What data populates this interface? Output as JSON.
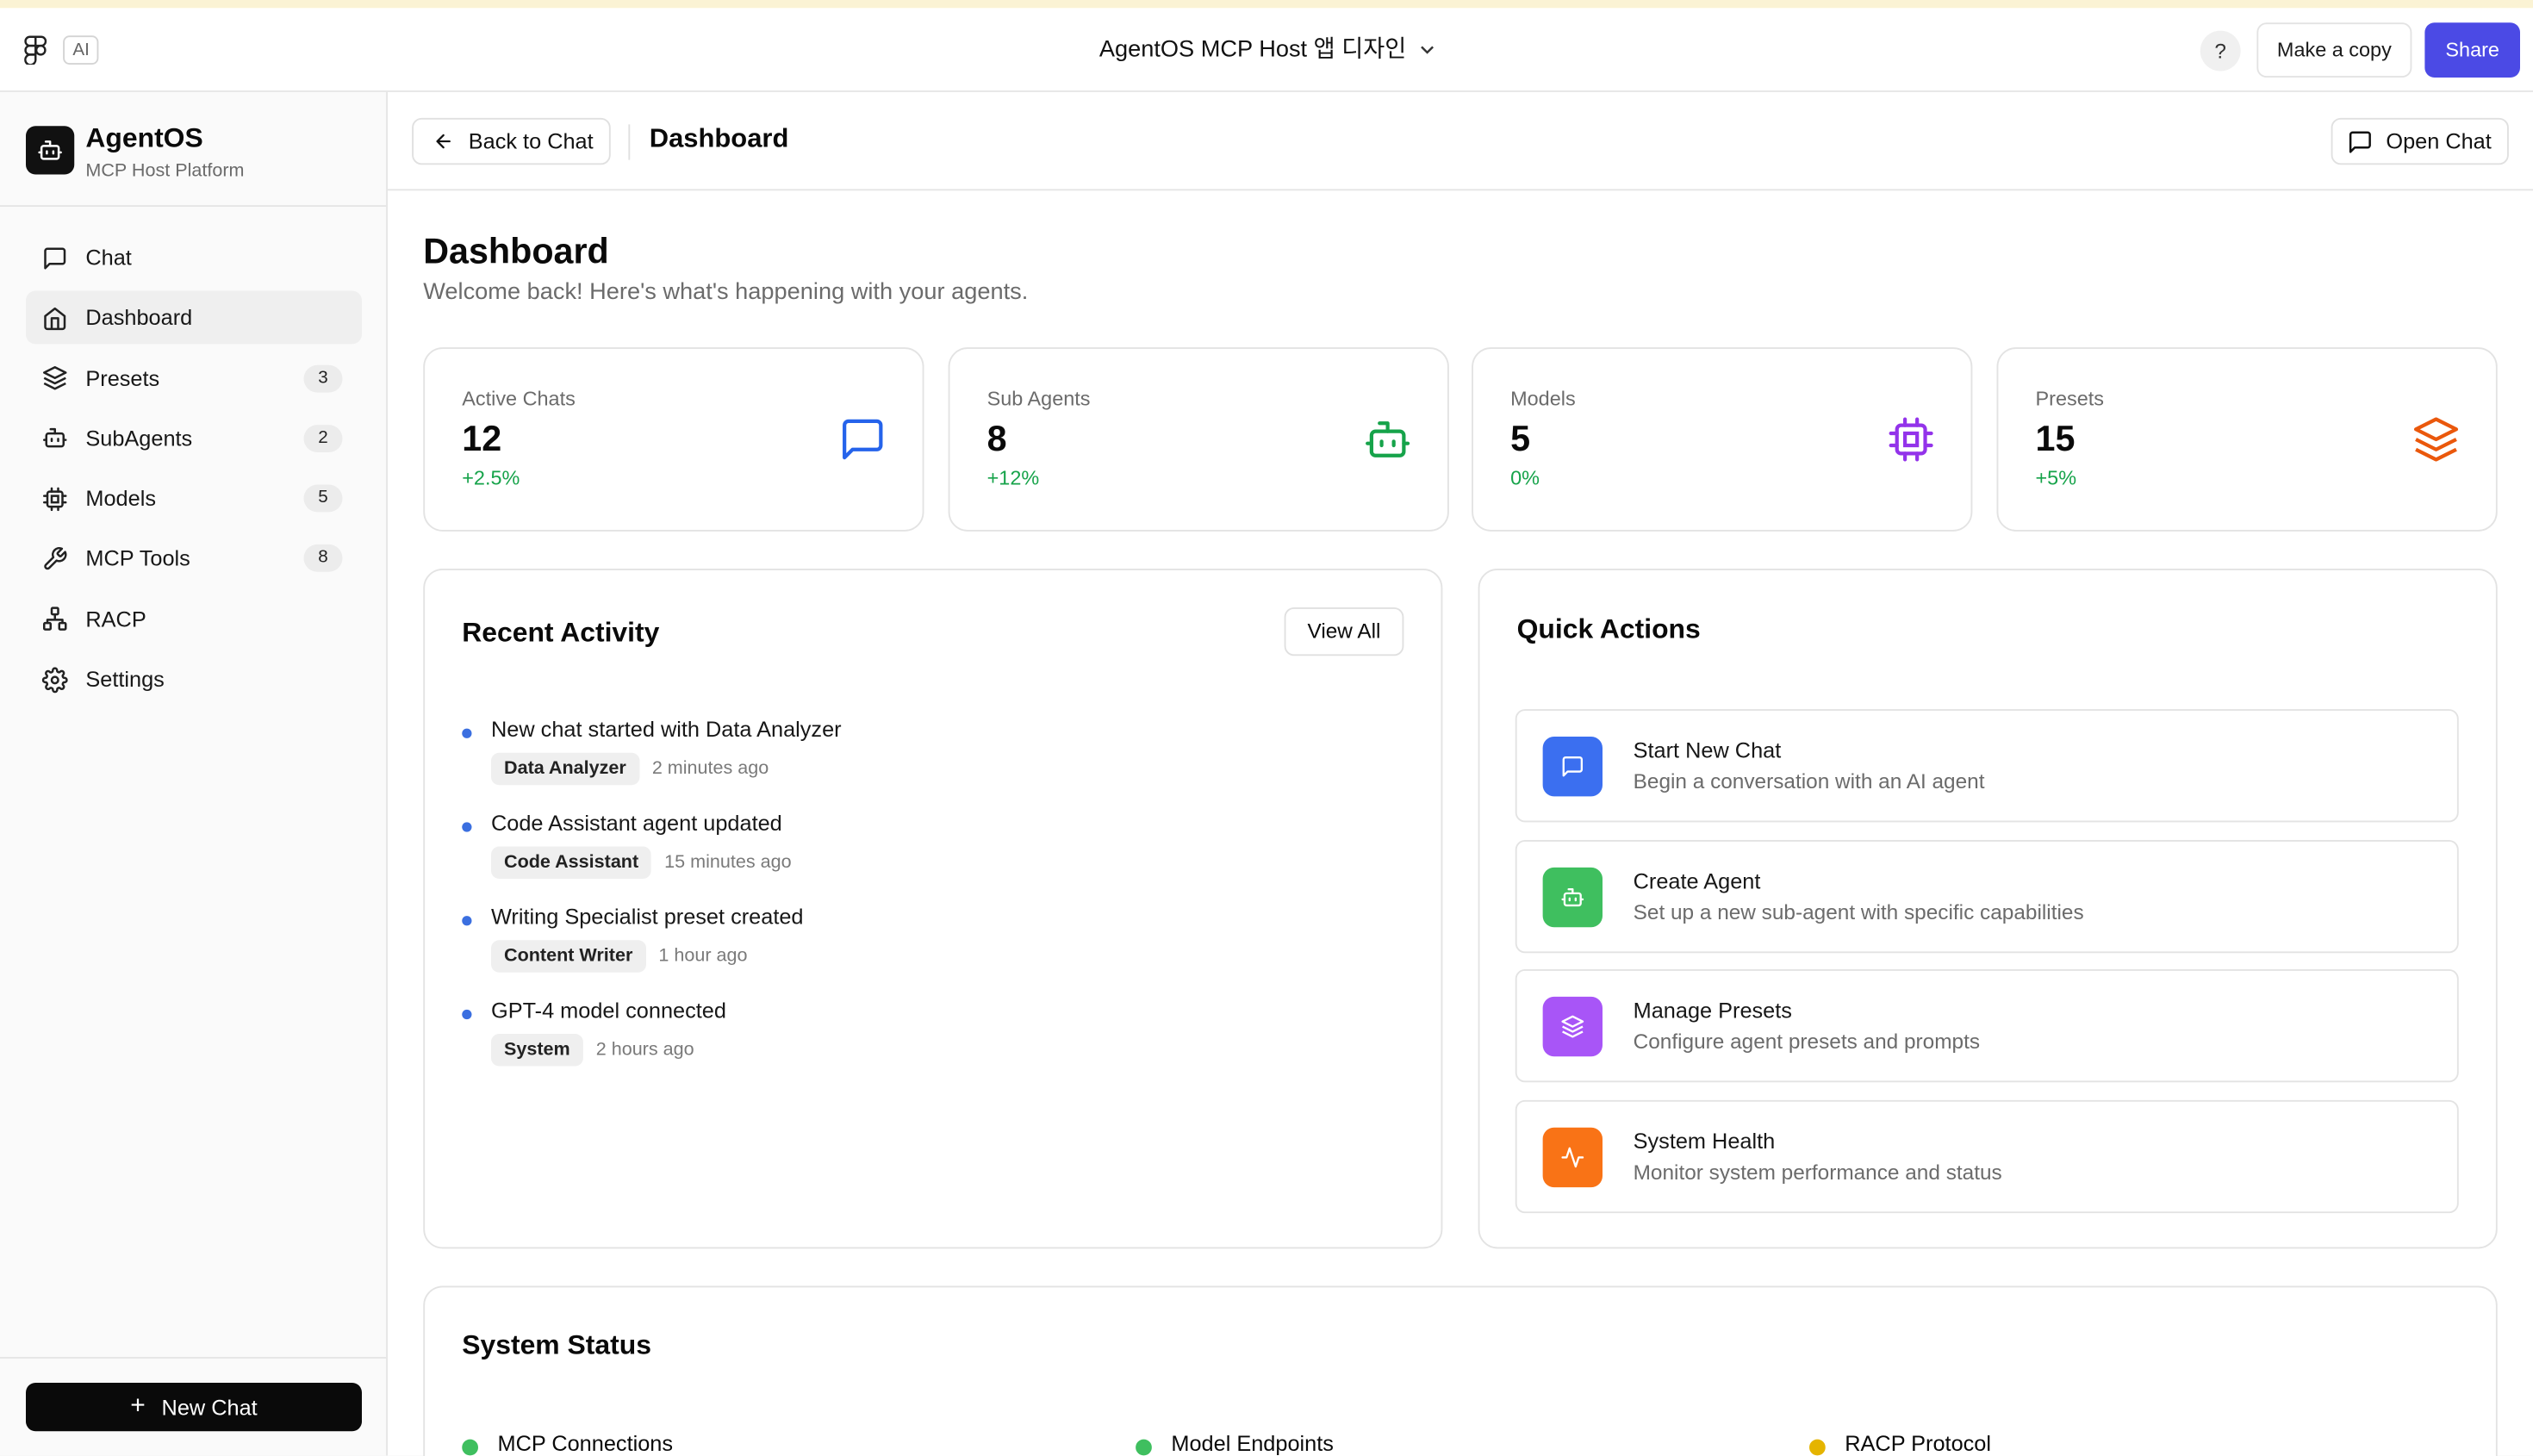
{
  "figma": {
    "ai_chip": "AI",
    "file_title": "AgentOS MCP Host 앱 디자인",
    "help": "?",
    "make_copy": "Make a copy",
    "share": "Share"
  },
  "sidebar": {
    "brand_name": "AgentOS",
    "brand_sub": "MCP Host Platform",
    "items": [
      {
        "label": "Chat",
        "icon": "chat-icon",
        "badge": null,
        "active": false
      },
      {
        "label": "Dashboard",
        "icon": "home-icon",
        "badge": null,
        "active": true
      },
      {
        "label": "Presets",
        "icon": "layers-icon",
        "badge": "3",
        "active": false
      },
      {
        "label": "SubAgents",
        "icon": "bot-icon",
        "badge": "2",
        "active": false
      },
      {
        "label": "Models",
        "icon": "cpu-icon",
        "badge": "5",
        "active": false
      },
      {
        "label": "MCP Tools",
        "icon": "wrench-icon",
        "badge": "8",
        "active": false
      },
      {
        "label": "RACP",
        "icon": "network-icon",
        "badge": null,
        "active": false
      },
      {
        "label": "Settings",
        "icon": "gear-icon",
        "badge": null,
        "active": false
      }
    ],
    "new_chat": "New Chat"
  },
  "header": {
    "back": "Back to Chat",
    "title": "Dashboard",
    "open_chat": "Open Chat"
  },
  "page": {
    "title": "Dashboard",
    "subtitle": "Welcome back! Here's what's happening with your agents."
  },
  "stats": [
    {
      "label": "Active Chats",
      "value": "12",
      "change": "+2.5%",
      "icon": "chat-icon",
      "color": "#2563eb"
    },
    {
      "label": "Sub Agents",
      "value": "8",
      "change": "+12%",
      "icon": "bot-icon",
      "color": "#16a34a"
    },
    {
      "label": "Models",
      "value": "5",
      "change": "0%",
      "icon": "cpu-icon",
      "color": "#9333ea"
    },
    {
      "label": "Presets",
      "value": "15",
      "change": "+5%",
      "icon": "layers-icon",
      "color": "#ea580c"
    }
  ],
  "activity": {
    "title": "Recent Activity",
    "view_all": "View All",
    "items": [
      {
        "text": "New chat started with Data Analyzer",
        "tag": "Data Analyzer",
        "time": "2 minutes ago"
      },
      {
        "text": "Code Assistant agent updated",
        "tag": "Code Assistant",
        "time": "15 minutes ago"
      },
      {
        "text": "Writing Specialist preset created",
        "tag": "Content Writer",
        "time": "1 hour ago"
      },
      {
        "text": "GPT-4 model connected",
        "tag": "System",
        "time": "2 hours ago"
      }
    ]
  },
  "quick_actions": {
    "title": "Quick Actions",
    "items": [
      {
        "title": "Start New Chat",
        "desc": "Begin a conversation with an AI agent",
        "icon": "chat-icon",
        "color": "#3b6ff0"
      },
      {
        "title": "Create Agent",
        "desc": "Set up a new sub-agent with specific capabilities",
        "icon": "bot-icon",
        "color": "#3fbf5f"
      },
      {
        "title": "Manage Presets",
        "desc": "Configure agent presets and prompts",
        "icon": "layers-icon",
        "color": "#a855f7"
      },
      {
        "title": "System Health",
        "desc": "Monitor system performance and status",
        "icon": "activity-icon",
        "color": "#f97316"
      }
    ]
  },
  "system_status": {
    "title": "System Status",
    "items": [
      {
        "label": "MCP Connections",
        "color": "#3fbf5f"
      },
      {
        "label": "Model Endpoints",
        "color": "#3fbf5f"
      },
      {
        "label": "RACP Protocol",
        "color": "#e5b400"
      }
    ]
  }
}
